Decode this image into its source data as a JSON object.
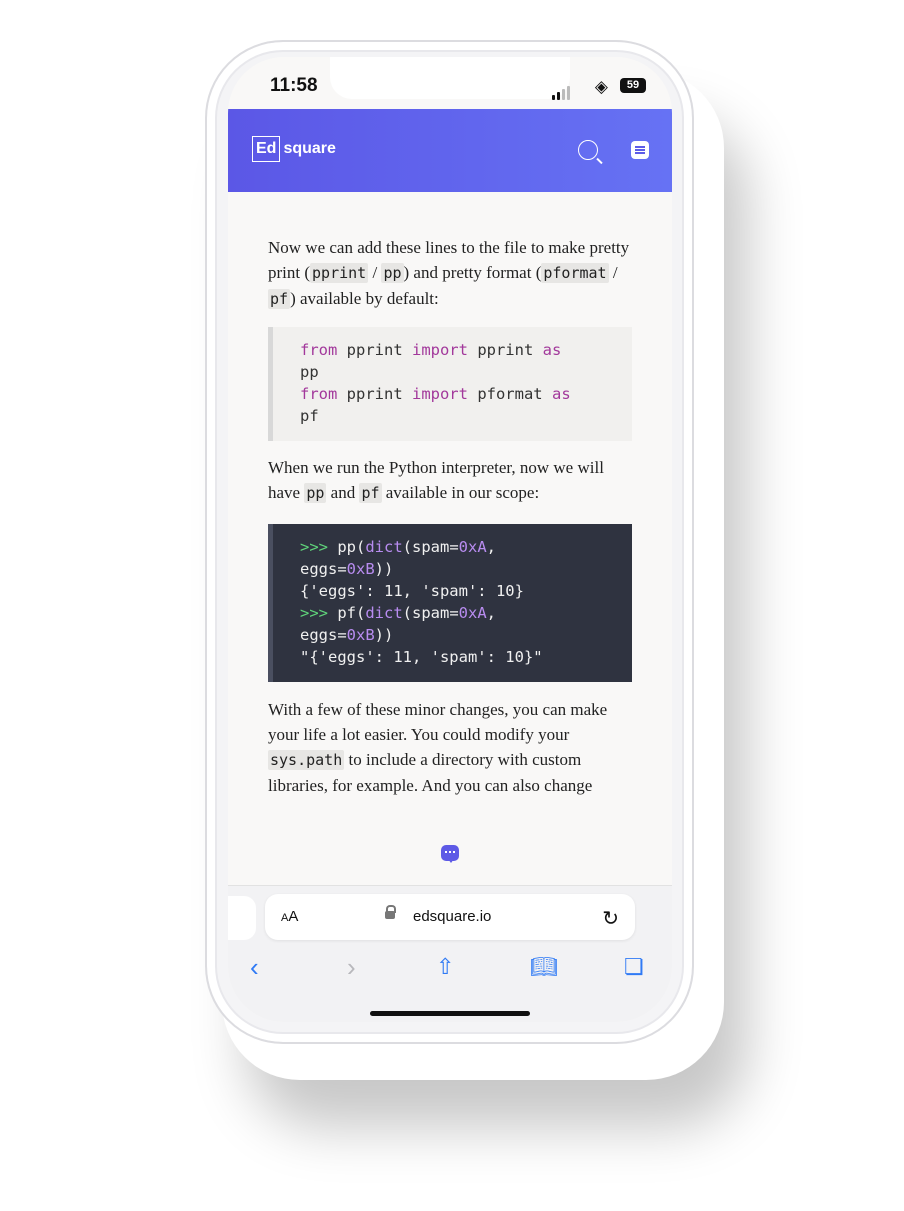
{
  "status": {
    "time": "11:58",
    "battery": "59"
  },
  "header": {
    "logo_box": "Ed",
    "logo_text": "square"
  },
  "article": {
    "para1": [
      {
        "t": "Now we can add these lines to the file to make pretty print ("
      },
      {
        "c": "pprint"
      },
      {
        "t": " / "
      },
      {
        "c": "pp"
      },
      {
        "t": ") and pretty format ("
      },
      {
        "c": "pformat"
      },
      {
        "t": " / "
      },
      {
        "c": "pf"
      },
      {
        "t": ") available by default:"
      }
    ],
    "code1": {
      "line1_kw1": "from",
      "line1_a": " pprint ",
      "line1_kw2": "import",
      "line1_b": " pprint ",
      "line1_kw3": "as",
      "line2": "pp",
      "line3_kw1": "from",
      "line3_a": " pprint ",
      "line3_kw2": "import",
      "line3_b": " pformat ",
      "line3_kw3": "as",
      "line4": "pf"
    },
    "para2": [
      {
        "t": "When we run the Python interpreter, now we will have "
      },
      {
        "c": "pp"
      },
      {
        "t": " and "
      },
      {
        "c": "pf"
      },
      {
        "t": " available in our scope:"
      }
    ],
    "code2": {
      "prompt": ">>>",
      "l1_a": " pp(",
      "l1_fn": "dict",
      "l1_b": "(spam=",
      "l1_n": "0xA",
      "l1_c": ",",
      "l2_a": "eggs=",
      "l2_n": "0xB",
      "l2_b": "))",
      "l3": "{'eggs': 11, 'spam': 10}",
      "l4_a": " pf(",
      "l4_fn": "dict",
      "l4_b": "(spam=",
      "l4_n": "0xA",
      "l4_c": ",",
      "l5_a": "eggs=",
      "l5_n": "0xB",
      "l5_b": "))",
      "l6": "\"{'eggs': 11, 'spam': 10}\""
    },
    "para3": [
      {
        "t": "With a few of these minor changes, you can make your life a lot easier. You could modify your "
      },
      {
        "c": "sys.path"
      },
      {
        "t": " to include a directory with custom libraries, for example. And you can also change"
      }
    ]
  },
  "browser": {
    "aa_small": "A",
    "aa_big": "A",
    "url": "edsquare.io"
  },
  "icons": {
    "search": "search-icon",
    "menu": "menu-icon",
    "chat": "chat-icon",
    "lock": "lock-icon",
    "reload": "reload-icon",
    "back": "chevron-left-icon",
    "forward": "chevron-right-icon",
    "share": "share-icon",
    "bookmarks": "book-icon",
    "tabs": "tabs-icon"
  },
  "colors": {
    "header_start": "#5b57e6",
    "header_end": "#6672f4",
    "keyword": "#a2389b",
    "prompt": "#5fd37a",
    "nav_blue": "#2f7af5"
  }
}
